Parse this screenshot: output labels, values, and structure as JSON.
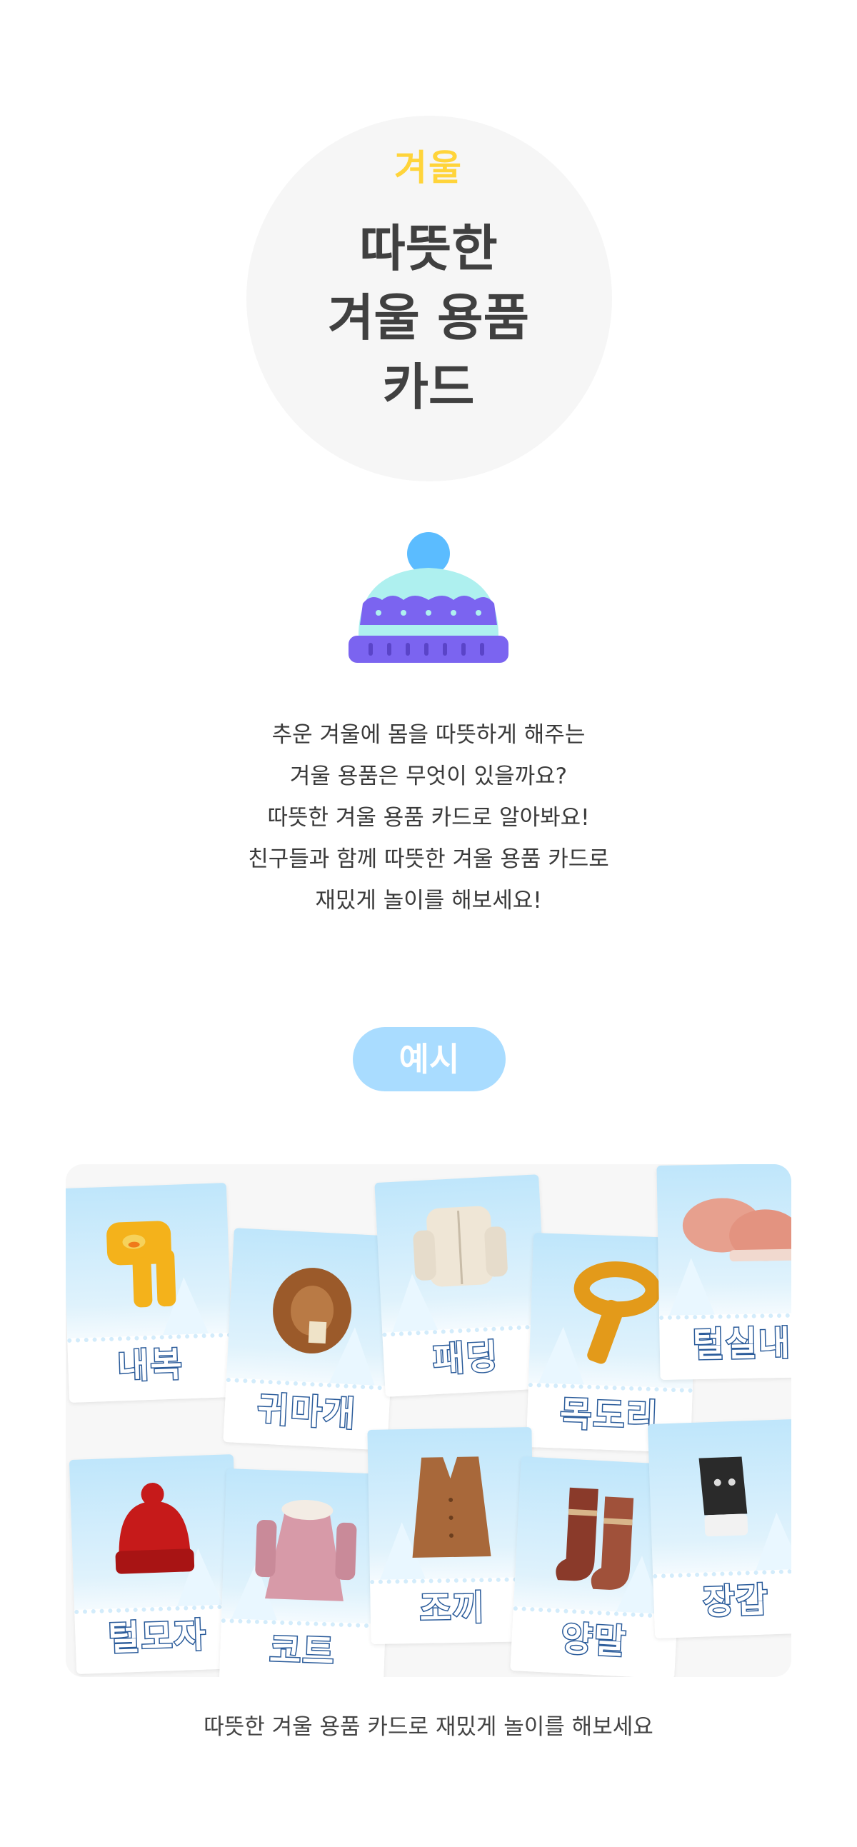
{
  "hero": {
    "season": "겨울",
    "title_lines": [
      "따뜻한",
      "겨울 용품",
      "카드"
    ]
  },
  "intro": {
    "lines": [
      "추운 겨울에 몸을 따뜻하게 해주는",
      "겨울 용품은 무엇이 있을까요?",
      "따뜻한 겨울 용품 카드로 알아봐요!",
      "친구들과 함께 따뜻한 겨울 용품 카드로",
      "재밌게 놀이를 해보세요!"
    ]
  },
  "example_label": "예시",
  "cards": [
    {
      "label": "내복",
      "icon": "pajamas-icon",
      "color": "#f4b21b"
    },
    {
      "label": "귀마개",
      "icon": "earmuffs-icon",
      "color": "#9b5a2a"
    },
    {
      "label": "패딩",
      "icon": "padded-jacket-icon",
      "color": "#efe6d6"
    },
    {
      "label": "목도리",
      "icon": "scarf-icon",
      "color": "#e39a1a"
    },
    {
      "label": "털실내",
      "icon": "slippers-icon",
      "color": "#e7a08e"
    },
    {
      "label": "털모자",
      "icon": "knit-hat-icon",
      "color": "#c61a1a"
    },
    {
      "label": "코트",
      "icon": "coat-icon",
      "color": "#d79aa8"
    },
    {
      "label": "조끼",
      "icon": "vest-icon",
      "color": "#a8683a"
    },
    {
      "label": "양말",
      "icon": "socks-icon",
      "color": "#8a3a2a"
    },
    {
      "label": "장갑",
      "icon": "gloves-icon",
      "color": "#2a2a2a"
    }
  ],
  "footer": "따뜻한 겨울 용품 카드로 재밌게 놀이를 해보세요",
  "colors": {
    "season": "#ffd43a",
    "pill": "#a9dcff",
    "hat_purple": "#7b64f0",
    "hat_mint": "#aef0ef",
    "hat_pompom": "#5bbcff"
  }
}
